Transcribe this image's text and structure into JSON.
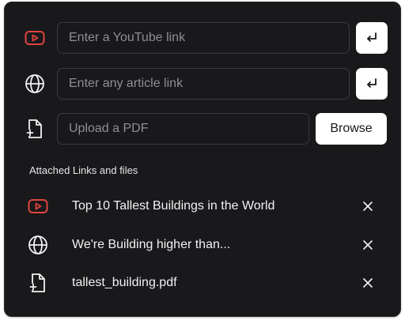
{
  "inputs": {
    "youtube": {
      "placeholder": "Enter a YouTube link",
      "icon": "youtube-icon"
    },
    "article": {
      "placeholder": "Enter any article link",
      "icon": "globe-icon"
    },
    "pdf": {
      "placeholder": "Upload a PDF",
      "icon": "file-plus-icon",
      "button_label": "Browse"
    }
  },
  "attachments": {
    "heading": "Attached Links and files",
    "items": [
      {
        "type": "youtube",
        "icon": "youtube-icon",
        "label": "Top 10 Tallest Buildings in the World"
      },
      {
        "type": "article",
        "icon": "globe-icon",
        "label": "We're Building higher than..."
      },
      {
        "type": "pdf",
        "icon": "file-plus-icon",
        "label": "tallest_building.pdf"
      }
    ]
  },
  "colors": {
    "panel_bg": "#19191b",
    "youtube_red": "#e0443e",
    "text_primary": "#f2f2f4",
    "placeholder": "#8f8f94",
    "button_bg": "#ffffff"
  }
}
